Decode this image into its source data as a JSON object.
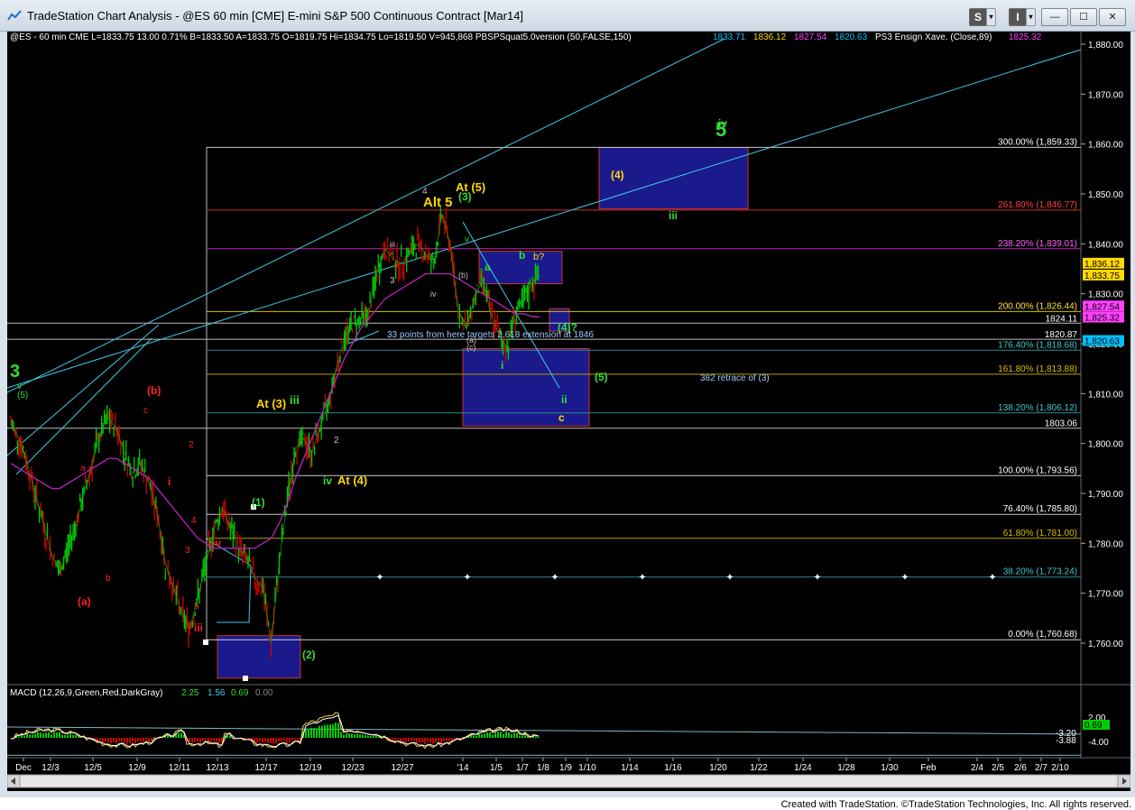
{
  "window": {
    "title": "TradeStation Chart Analysis - @ES 60 min [CME] E-mini S&P 500 Continuous Contract [Mar14]",
    "buttons": {
      "s": "S",
      "menu1": "▾",
      "i": "I",
      "menu2": "▾",
      "minimize": "—",
      "maximize": "☐",
      "close": "✕"
    }
  },
  "header": {
    "symbol_line": "@ES - 60 min  CME  L=1833.75  13.00  0.71%  B=1833.50  A=1833.75  O=1819.75  Hi=1834.75  Lo=1819.50  V=945,868  PBSPSquat5.0version (50,FALSE,150)",
    "ind_values": [
      "1833.71",
      "1836.12",
      "1827.54",
      "1820.63"
    ],
    "ind_colors": [
      "#00bfff",
      "#ffd800",
      "#ff40ff",
      "#00bfff"
    ],
    "ensign": "PS3 Ensign Xave. (Close,89)",
    "ensign_value": "1825.32"
  },
  "colors": {
    "background": "#000000",
    "up_bar": "#00cc00",
    "down_bar": "#cc0000",
    "magenta_ma": "#c020c0",
    "cyan": "#40c8e8",
    "yellow": "#ffd700",
    "green_label": "#33dd33",
    "red_label": "#ff2020",
    "blue_box": "#1a1a8c"
  },
  "chart_data": {
    "type": "line",
    "title": "",
    "xlabel": "",
    "ylabel": "",
    "ylim": [
      1753,
      1884
    ],
    "x_tick_labels": [
      "Dec",
      "12/3",
      "12/5",
      "12/9",
      "12/11",
      "12/13",
      "12/17",
      "12/19",
      "12/23",
      "12/27",
      "'14",
      "1/5",
      "1/7",
      "1/8",
      "1/9",
      "1/10",
      "1/14",
      "1/16",
      "1/20",
      "1/22",
      "1/24",
      "1/28",
      "1/30",
      "Feb",
      "2/4",
      "2/5",
      "2/6",
      "2/7",
      "2/10"
    ],
    "y_tick_labels": [
      "1,880.00",
      "1,870.00",
      "1,860.00",
      "1,850.00",
      "1,840.00",
      "1,830.00",
      "1,820.00",
      "1,810.00",
      "1,800.00",
      "1,790.00",
      "1,780.00",
      "1,770.00",
      "1,760.00"
    ],
    "y_ticks": [
      1880,
      1870,
      1860,
      1850,
      1840,
      1830,
      1820,
      1810,
      1800,
      1790,
      1780,
      1770,
      1760
    ],
    "series": [
      {
        "values": [
          1804,
          1801,
          1796,
          1790,
          1784,
          1778,
          1774,
          1779,
          1784,
          1790,
          1796,
          1802,
          1805,
          1803,
          1798,
          1794,
          1796,
          1792,
          1786,
          1776,
          1771,
          1766,
          1763,
          1769,
          1776,
          1783,
          1787,
          1783,
          1779,
          1777,
          1773,
          1771,
          1760,
          1776,
          1789,
          1799,
          1801,
          1798,
          1803,
          1808,
          1815,
          1821,
          1824,
          1825,
          1826,
          1834,
          1839,
          1837,
          1836,
          1838,
          1840,
          1838,
          1836,
          1846,
          1840,
          1827,
          1823,
          1829,
          1833,
          1826,
          1822,
          1819,
          1826,
          1828,
          1832,
          1833.75
        ]
      },
      {
        "values": [
          1796,
          1795,
          1794,
          1793,
          1792,
          1791,
          1791,
          1792,
          1793,
          1794,
          1795,
          1796,
          1797,
          1797,
          1796,
          1795,
          1794,
          1793,
          1791,
          1789,
          1787,
          1785,
          1783,
          1781,
          1780,
          1779,
          1779,
          1779,
          1779,
          1779,
          1779,
          1780,
          1781,
          1784,
          1788,
          1793,
          1797,
          1801,
          1805,
          1809,
          1813,
          1817,
          1820,
          1823,
          1825,
          1827,
          1829,
          1830,
          1831,
          1832,
          1833,
          1834,
          1834,
          1834,
          1834,
          1833,
          1832,
          1831,
          1830,
          1829,
          1828,
          1827,
          1826,
          1826,
          1825.5,
          1825.32
        ]
      }
    ],
    "horizontal_levels": [
      {
        "label": "300.00% (1,859.33)",
        "value": 1859.33
      },
      {
        "label": "261.80% (1,846.77)",
        "value": 1846.77
      },
      {
        "label": "238.20% (1,839.01)",
        "value": 1839.01
      },
      {
        "label": "200.00% (1,826.44)",
        "value": 1826.44
      },
      {
        "label": "176.40% (1,818.68)",
        "value": 1818.68
      },
      {
        "label": "161.80% (1,813.88)",
        "value": 1813.88
      },
      {
        "label": "138.20% (1,806.12)",
        "value": 1806.12
      },
      {
        "label": "100.00% (1,793.56)",
        "value": 1793.56
      },
      {
        "label": "76.40% (1,785.80)",
        "value": 1785.8
      },
      {
        "label": "61.80% (1,781.00)",
        "value": 1781.0
      },
      {
        "label": "38.20% (1,773.24)",
        "value": 1773.24
      },
      {
        "label": "0.00% (1,760.68)",
        "value": 1760.68
      }
    ],
    "plain_levels": [
      {
        "label": "1824.11",
        "value": 1824.11
      },
      {
        "label": "1820.87",
        "value": 1820.87
      },
      {
        "label": "1803.06",
        "value": 1803.06
      }
    ],
    "price_tags": [
      {
        "label": "1,836.12",
        "value": 1836.12,
        "color": "#ffd800"
      },
      {
        "label": "1,833.75",
        "value": 1833.75,
        "color": "#ffd800"
      },
      {
        "label": "1,827.54",
        "value": 1827.54,
        "color": "#ff40ff"
      },
      {
        "label": "1,825.32",
        "value": 1825.32,
        "color": "#ff40ff"
      },
      {
        "label": "1,820.63",
        "value": 1820.63,
        "color": "#00bfff"
      }
    ],
    "annotations": [
      {
        "text": "3",
        "color": "#33dd33",
        "size": 20
      },
      {
        "text": "v",
        "color": "#33dd33",
        "size": 10
      },
      {
        "text": "(5)",
        "color": "#33dd33",
        "size": 10
      },
      {
        "text": "(b)",
        "color": "#ff2020",
        "size": 12
      },
      {
        "text": "c",
        "color": "#ff2020",
        "size": 10
      },
      {
        "text": "a",
        "color": "#ff2020",
        "size": 10
      },
      {
        "text": "(a)",
        "color": "#ff2020",
        "size": 12
      },
      {
        "text": "b",
        "color": "#ff2020",
        "size": 10
      },
      {
        "text": "i",
        "color": "#ff2020",
        "size": 12
      },
      {
        "text": "iii",
        "color": "#ff2020",
        "size": 12
      },
      {
        "text": "iv",
        "color": "#ff2020",
        "size": 12
      },
      {
        "text": "5",
        "color": "#ff2020",
        "size": 10
      },
      {
        "text": "4",
        "color": "#ff2020",
        "size": 10
      },
      {
        "text": "3",
        "color": "#ff2020",
        "size": 10
      },
      {
        "text": "2",
        "color": "#ff2020",
        "size": 10
      },
      {
        "text": "(1)",
        "color": "#33dd33",
        "size": 12
      },
      {
        "text": "(2)",
        "color": "#33dd33",
        "size": 12
      },
      {
        "text": "At (3)",
        "color": "#ffd700",
        "size": 13
      },
      {
        "text": "iii",
        "color": "#33dd33",
        "size": 13
      },
      {
        "text": "iv",
        "color": "#33dd33",
        "size": 12
      },
      {
        "text": "At (4)",
        "color": "#ffd700",
        "size": 13
      },
      {
        "text": "2",
        "color": "#c0c0c0",
        "size": 10
      },
      {
        "text": "iii",
        "color": "#c0c0c0",
        "size": 9
      },
      {
        "text": "3",
        "color": "#c0c0c0",
        "size": 10
      },
      {
        "text": "iv",
        "color": "#c0c0c0",
        "size": 9
      },
      {
        "text": "4",
        "color": "#c0c0c0",
        "size": 10
      },
      {
        "text": "Alt 5",
        "color": "#ffd700",
        "size": 15
      },
      {
        "text": "At (5)",
        "color": "#ffd700",
        "size": 13
      },
      {
        "text": "(3)",
        "color": "#33dd33",
        "size": 12
      },
      {
        "text": "v",
        "color": "#33dd33",
        "size": 10
      },
      {
        "text": "(b)",
        "color": "#c0c0c0",
        "size": 9
      },
      {
        "text": "(a)",
        "color": "#c0c0c0",
        "size": 9
      },
      {
        "text": "(c)",
        "color": "#c0c0c0",
        "size": 9
      },
      {
        "text": "a",
        "color": "#33dd33",
        "size": 12
      },
      {
        "text": "b",
        "color": "#33dd33",
        "size": 12
      },
      {
        "text": "b?",
        "color": "#ffd700",
        "size": 11
      },
      {
        "text": "i",
        "color": "#33dd33",
        "size": 12
      },
      {
        "text": "(4)?",
        "color": "#33dd33",
        "size": 12
      },
      {
        "text": "ii",
        "color": "#33dd33",
        "size": 12
      },
      {
        "text": "c",
        "color": "#ffd700",
        "size": 12
      },
      {
        "text": "(4)",
        "color": "#ffd700",
        "size": 12
      },
      {
        "text": "iii",
        "color": "#33dd33",
        "size": 12
      },
      {
        "text": "iv",
        "color": "#33dd33",
        "size": 12
      },
      {
        "text": "5",
        "color": "#33dd33",
        "size": 22
      },
      {
        "text": "(5)",
        "color": "#33dd33",
        "size": 12
      },
      {
        "text": "382 retrace of (3)",
        "color": "#a0c8ff",
        "size": 10
      },
      {
        "text": "33 points from here targets 2.618 extension at 1846",
        "color": "#a0c8ff",
        "size": 10
      },
      {
        "text": "ii",
        "color": "#c0c0c0",
        "size": 9
      }
    ]
  },
  "macd": {
    "label": "MACD (12,26,9,Green,Red,DarkGray)",
    "v1": "2.25",
    "v2": "1.56",
    "v3": "0.69",
    "v4": "0.00",
    "axis_labels": [
      "2.00",
      "0.69",
      "-3.20",
      "-3.88",
      "-4.00"
    ]
  },
  "footer": {
    "credit": "Created with TradeStation. ©TradeStation Technologies, Inc. All rights reserved."
  }
}
